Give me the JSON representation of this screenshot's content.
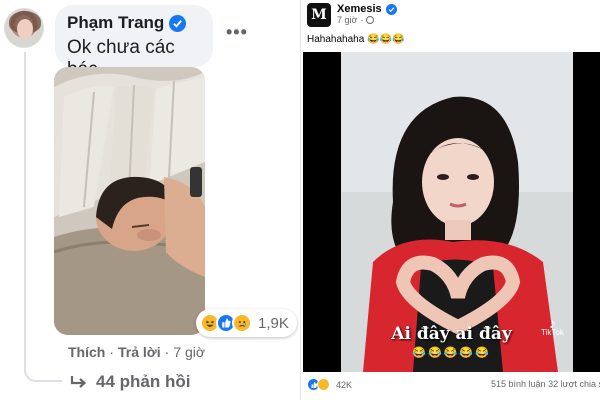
{
  "comment": {
    "author": "Phạm Trang",
    "text": "Ok chưa các bác",
    "more_icon": "more-horizontal-icon",
    "reactions_count": "1,9K",
    "reaction_icons": [
      "haha-reaction-icon",
      "like-reaction-icon",
      "sad-reaction-icon"
    ],
    "like_label": "Thích",
    "reply_label": "Trả lời",
    "separator": "·",
    "time": "7 giờ",
    "replies_label": "44 phản hồi"
  },
  "post": {
    "author": "Xemesis",
    "time": "7 giờ",
    "caption": "Hahahahaha 😂😂😂",
    "video_text": "Ai đây ai đây",
    "video_emojis": "😂😂😂😂😂",
    "watermark": "TikTok",
    "reactions_count": "42K",
    "comments": "515 bình luận",
    "shares": "32 lượt chia s"
  },
  "colors": {
    "brand_blue": "#1877f2",
    "haha_yellow": "#f7b928",
    "muted_text": "#65676b",
    "bubble_bg": "#f0f2f5"
  }
}
